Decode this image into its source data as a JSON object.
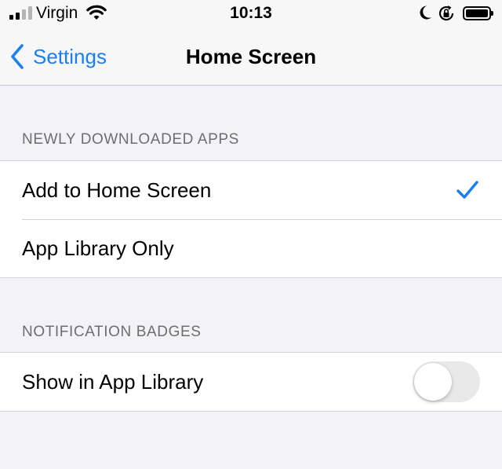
{
  "status_bar": {
    "carrier": "Virgin",
    "time": "10:13",
    "signal_bars_active": 2,
    "battery_level": 1.0,
    "icons": [
      "signal-icon",
      "wifi-icon",
      "moon-icon",
      "rotation-lock-icon",
      "battery-icon"
    ]
  },
  "nav": {
    "back_label": "Settings",
    "title": "Home Screen",
    "back_icon": "chevron-left-icon"
  },
  "sections": [
    {
      "header": "NEWLY DOWNLOADED APPS",
      "rows": [
        {
          "label": "Add to Home Screen",
          "selected": true
        },
        {
          "label": "App Library Only",
          "selected": false
        }
      ]
    },
    {
      "header": "NOTIFICATION BADGES",
      "rows": [
        {
          "label": "Show in App Library",
          "toggle_on": false
        }
      ]
    }
  ],
  "colors": {
    "accent": "#1a7ef5",
    "background": "#f2f2f7",
    "cell": "#ffffff",
    "separator": "#d1d1d6",
    "section_header": "#6d6d72",
    "toggle_off": "#e9e9ea"
  }
}
